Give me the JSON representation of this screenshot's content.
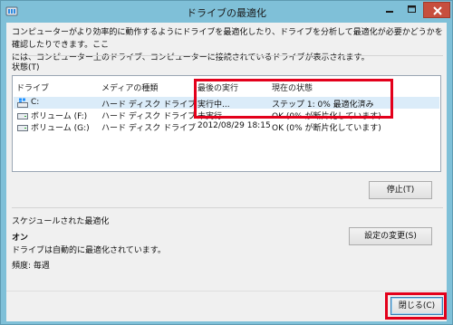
{
  "window": {
    "title": "ドライブの最適化"
  },
  "intro": {
    "line1": "コンピューターがより効率的に動作するようにドライブを最適化したり、ドライブを分析して最適化が必要かどうかを確認したりできます。ここ",
    "line2": "には、コンピューター上のドライブ、コンピューターに接続されているドライブが表示されます。"
  },
  "status": {
    "label": "状態(T)",
    "columns": [
      "ドライブ",
      "メディアの種類",
      "最後の実行",
      "現在の状態"
    ],
    "rows": [
      {
        "drive": "C:",
        "media": "ハード ディスク ドライブ",
        "last_run": "実行中...",
        "status": "ステップ 1: 0% 最適化済み"
      },
      {
        "drive": "ボリューム (F:)",
        "media": "ハード ディスク ドライブ",
        "last_run": "未実行",
        "status": "OK (0% が断片化しています)"
      },
      {
        "drive": "ボリューム (G:)",
        "media": "ハード ディスク ドライブ",
        "last_run": "2012/08/29 18:15",
        "status": "OK (0% が断片化しています)"
      }
    ],
    "stop_button": "停止(T)"
  },
  "schedule": {
    "label": "スケジュールされた最適化",
    "state": "オン",
    "description": "ドライブは自動的に最適化されています。",
    "frequency": "頻度: 毎週",
    "change_button": "設定の変更(S)"
  },
  "footer": {
    "close_button": "閉じる(C)"
  },
  "colors": {
    "highlight": "#e3001b",
    "titlebar": "#7fc0d8",
    "selected_row": "#dbecf9"
  }
}
